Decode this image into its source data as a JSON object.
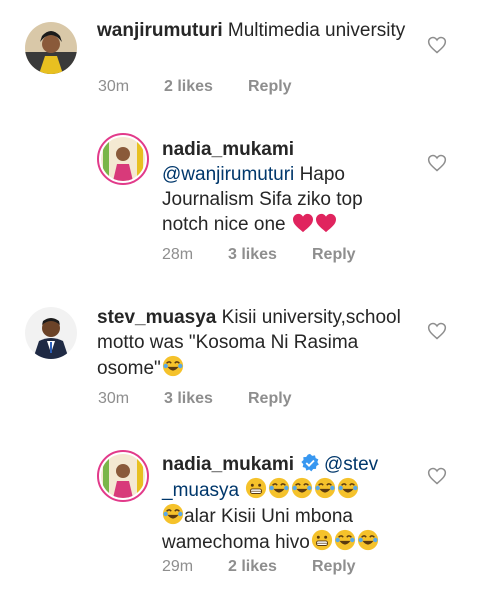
{
  "comments": [
    {
      "username": "wanjirumuturi",
      "text": "Multimedia university",
      "time": "30m",
      "likes": "2 likes",
      "reply": "Reply"
    },
    {
      "username": "nadia_mukami",
      "mention": "@wanjirumuturi",
      "text": "Hapo Journalism Sifa ziko top notch nice one",
      "time": "28m",
      "likes": "3 likes",
      "reply": "Reply"
    },
    {
      "username": "stev_muasya",
      "text": "Kisii university,school motto was \"Kosoma Ni Rasima osome\"",
      "time": "30m",
      "likes": "3 likes",
      "reply": "Reply"
    },
    {
      "username": "nadia_mukami",
      "mention_part1": "@stev",
      "mention_part2": "_muasya",
      "text": "alar Kisii Uni mbona wamechoma hivo",
      "time": "29m",
      "likes": "2 likes",
      "reply": "Reply"
    }
  ],
  "colors": {
    "heart": "#e0245e",
    "mention": "#00376b",
    "meta": "#8e8e8e",
    "verified": "#3897f0"
  }
}
